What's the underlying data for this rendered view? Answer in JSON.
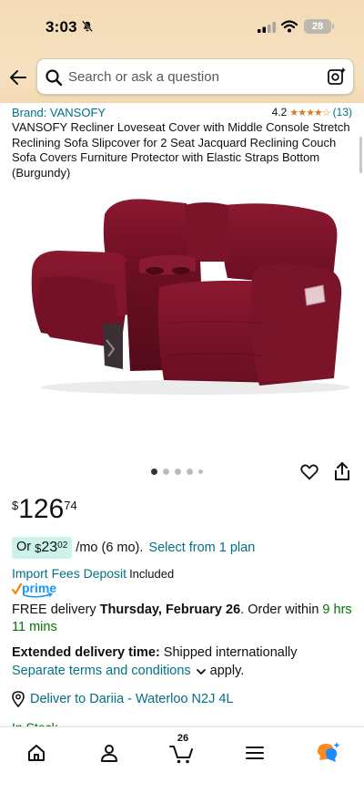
{
  "status_bar": {
    "time": "3:03",
    "battery": "28"
  },
  "search": {
    "placeholder": "Search or ask a question"
  },
  "product": {
    "brand": "Brand: VANSOFY",
    "rating": "4.2",
    "stars": "★★★★☆",
    "review_count": "(13)",
    "title": "VANSOFY Recliner Loveseat Cover with Middle Console Stretch Reclining Sofa Slipcover for 2 Seat Jacquard Reclining Couch Sofa Covers Furniture Protector with Elastic Straps Bottom (Burgundy)",
    "image_icon": "burgundy-loveseat-image",
    "carousel_total": 5,
    "carousel_active": 1
  },
  "price": {
    "symbol": "$",
    "whole": "126",
    "fraction": "74"
  },
  "monthly": {
    "prefix": "Or ",
    "symbol": "$",
    "whole": "23",
    "fraction": "02",
    "per": "/mo (6 mo).",
    "link": "Select from 1 plan"
  },
  "import_fees": {
    "link": "Import Fees Deposit",
    "status": "Included"
  },
  "prime_label": "prime",
  "delivery": {
    "prefix": "FREE delivery ",
    "date": "Thursday, February 26",
    "middle": ". Order within ",
    "countdown": "9 hrs 11 mins"
  },
  "extended": {
    "label": "Extended delivery time:",
    "text": " Shipped internationally"
  },
  "terms": {
    "link": "Separate terms and conditions",
    "suffix": "apply."
  },
  "deliver_to": "Deliver to Dariia - Waterloo N2J 4L",
  "partial_text": "In Stock",
  "bottom_nav": {
    "cart_count": "26",
    "items": [
      "home-icon",
      "account-icon",
      "cart-icon",
      "menu-icon",
      "rufus-icon"
    ]
  },
  "colors": {
    "header_bg": "#f3dbb6",
    "link": "#007185",
    "green": "#007600",
    "star": "#de7921",
    "monthly_pill": "#ccf2ec",
    "product": "#7a1128"
  }
}
